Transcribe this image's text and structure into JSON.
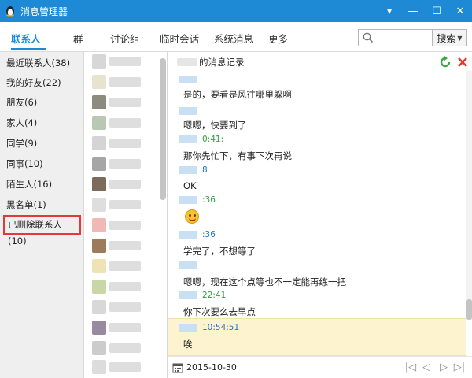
{
  "window": {
    "title": "消息管理器",
    "logo_icon": "qq-penguin-icon",
    "buttons": [
      "▾",
      "—",
      "☐",
      "✕"
    ]
  },
  "tabs": [
    "联系人",
    "群",
    "讨论组",
    "临时会话",
    "系统消息",
    "更多"
  ],
  "search": {
    "placeholder": "",
    "button_label": "搜索"
  },
  "groups": [
    "最近联系人(38)",
    "我的好友(22)",
    "朋友(6)",
    "家人(4)",
    "同学(9)",
    "同事(10)",
    "陌生人(16)",
    "黑名单(1)",
    "已删除联系人(10)"
  ],
  "chat": {
    "header_title": "的消息记录",
    "messages": [
      {
        "time": "",
        "text": "是的，要看是风往哪里躲啊"
      },
      {
        "time": "",
        "text": "嗯嗯，快要到了"
      },
      {
        "time": "0:41:",
        "text": "那你先忙下，有事下次再说"
      },
      {
        "time": "8",
        "text": "OK"
      },
      {
        "time": ":36",
        "text": ""
      },
      {
        "time": ":36",
        "text": "学完了，不想等了"
      },
      {
        "time": "",
        "text": "嗯嗯，现在这个点等也不一定能再练一把"
      },
      {
        "time": "22:41",
        "text": "你下次要么去早点"
      },
      {
        "time": "10:54:51",
        "text": "唉"
      }
    ],
    "footer_date": "2015-10-30",
    "pager": [
      "|◁",
      "◁",
      "▷",
      "▷|"
    ]
  },
  "colors": {
    "accent": "#1e8ad6",
    "highlight_border": "#e53935",
    "highlight_row": "#fdf3cf",
    "refresh_green": "#3aa844",
    "delete_red": "#e03b2d"
  }
}
